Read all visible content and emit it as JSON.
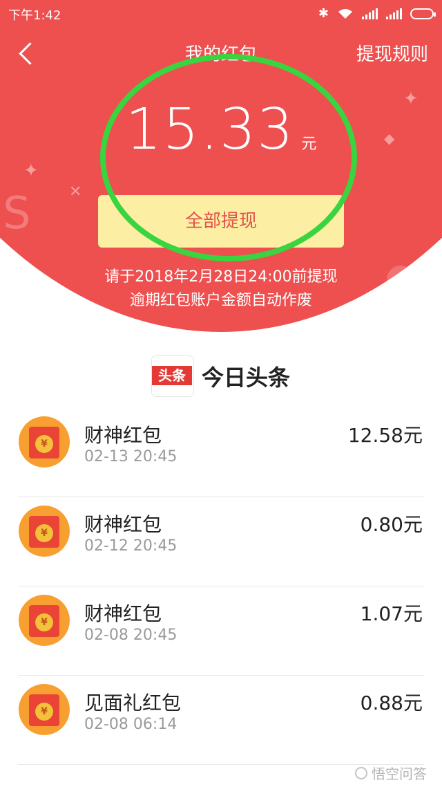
{
  "status_bar": {
    "time": "下午1:42",
    "icons": [
      "bluetooth-icon",
      "wifi-icon",
      "signal-icon",
      "signal-icon",
      "battery-icon"
    ]
  },
  "nav": {
    "title": "我的红包",
    "rules_link": "提现规则",
    "back_icon": "chevron-left-icon"
  },
  "balance": {
    "amount": "15.33",
    "unit": "元"
  },
  "withdraw_button": "全部提现",
  "notes": {
    "line1": "请于2018年2月28日24:00前提现",
    "line2": "逾期红包账户金额自动作废"
  },
  "brand": {
    "logo_text": "头条",
    "name": "今日头条"
  },
  "items": [
    {
      "title": "财神红包",
      "time": "02-13 20:45",
      "amount": "12.58元"
    },
    {
      "title": "财神红包",
      "time": "02-12 20:45",
      "amount": "0.80元"
    },
    {
      "title": "财神红包",
      "time": "02-08 20:45",
      "amount": "1.07元"
    },
    {
      "title": "见面礼红包",
      "time": "02-08 06:14",
      "amount": "0.88元"
    }
  ],
  "watermark": "悟空问答",
  "colors": {
    "header_red": "#ee4f4f",
    "button_yellow": "#fcefa3",
    "annotation_green": "#39d43f",
    "avatar_orange": "#f7a031"
  }
}
